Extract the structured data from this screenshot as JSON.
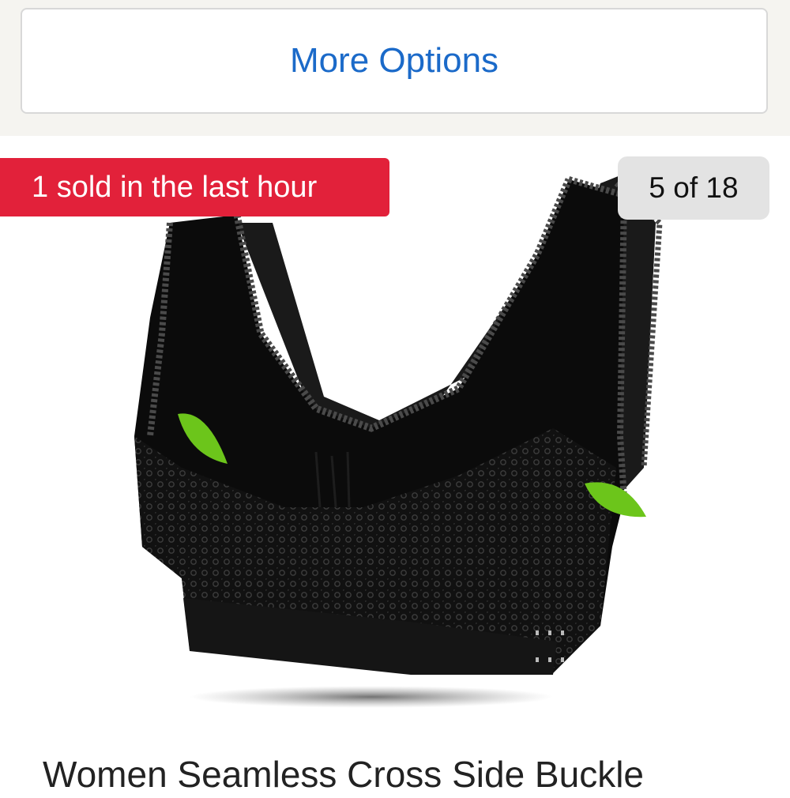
{
  "options": {
    "more_label": "More Options"
  },
  "gallery": {
    "sold_badge": "1 sold in the last hour",
    "counter": "5 of 18",
    "image_alt": "product photo"
  },
  "product": {
    "title": "Women Seamless Cross Side Buckle"
  },
  "colors": {
    "link_blue": "#1b6ac9",
    "badge_red": "#e2213a",
    "counter_bg": "#e3e3e3",
    "product_black": "#0b0b0b",
    "lace_grey": "#3a3a3a",
    "leaf_green": "#6cc51b"
  }
}
